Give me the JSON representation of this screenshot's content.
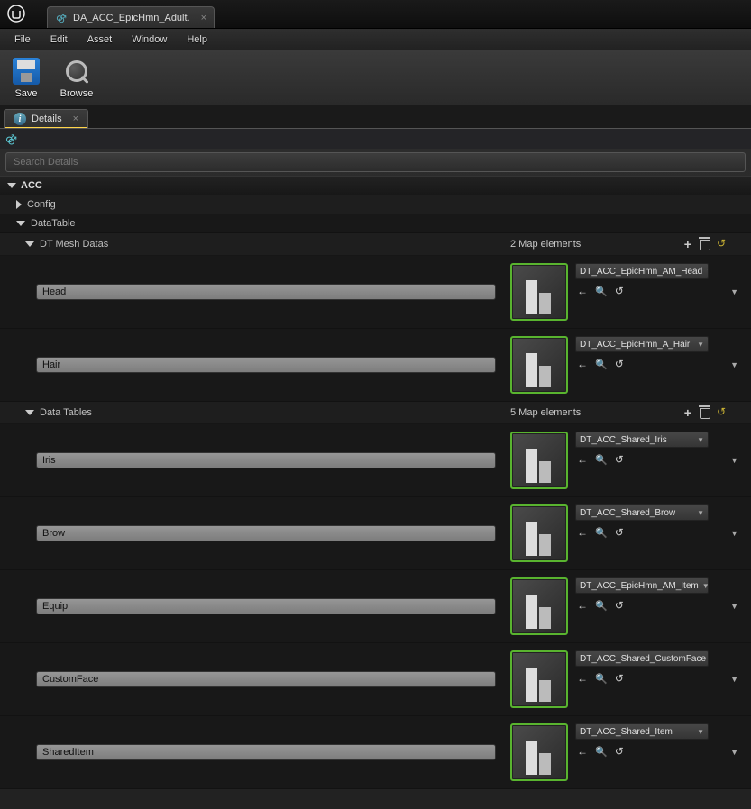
{
  "titlebar": {
    "tab_title": "DA_ACC_EpicHmn_Adult."
  },
  "menu": {
    "file": "File",
    "edit": "Edit",
    "asset": "Asset",
    "window": "Window",
    "help": "Help"
  },
  "toolbar": {
    "save": "Save",
    "browse": "Browse"
  },
  "panel": {
    "tab": "Details",
    "search_placeholder": "Search Details"
  },
  "cat": {
    "acc": "ACC",
    "config": "Config",
    "datatable": "DataTable"
  },
  "mesh_datas": {
    "label": "DT Mesh Datas",
    "summary": "2 Map elements",
    "items": [
      {
        "key": "Head",
        "asset": "DT_ACC_EpicHmn_AM_Head"
      },
      {
        "key": "Hair",
        "asset": "DT_ACC_EpicHmn_A_Hair"
      }
    ]
  },
  "data_tables": {
    "label": "Data Tables",
    "summary": "5 Map elements",
    "items": [
      {
        "key": "Iris",
        "asset": "DT_ACC_Shared_Iris"
      },
      {
        "key": "Brow",
        "asset": "DT_ACC_Shared_Brow"
      },
      {
        "key": "Equip",
        "asset": "DT_ACC_EpicHmn_AM_Item"
      },
      {
        "key": "CustomFace",
        "asset": "DT_ACC_Shared_CustomFace"
      },
      {
        "key": "SharedItem",
        "asset": "DT_ACC_Shared_Item"
      }
    ]
  }
}
